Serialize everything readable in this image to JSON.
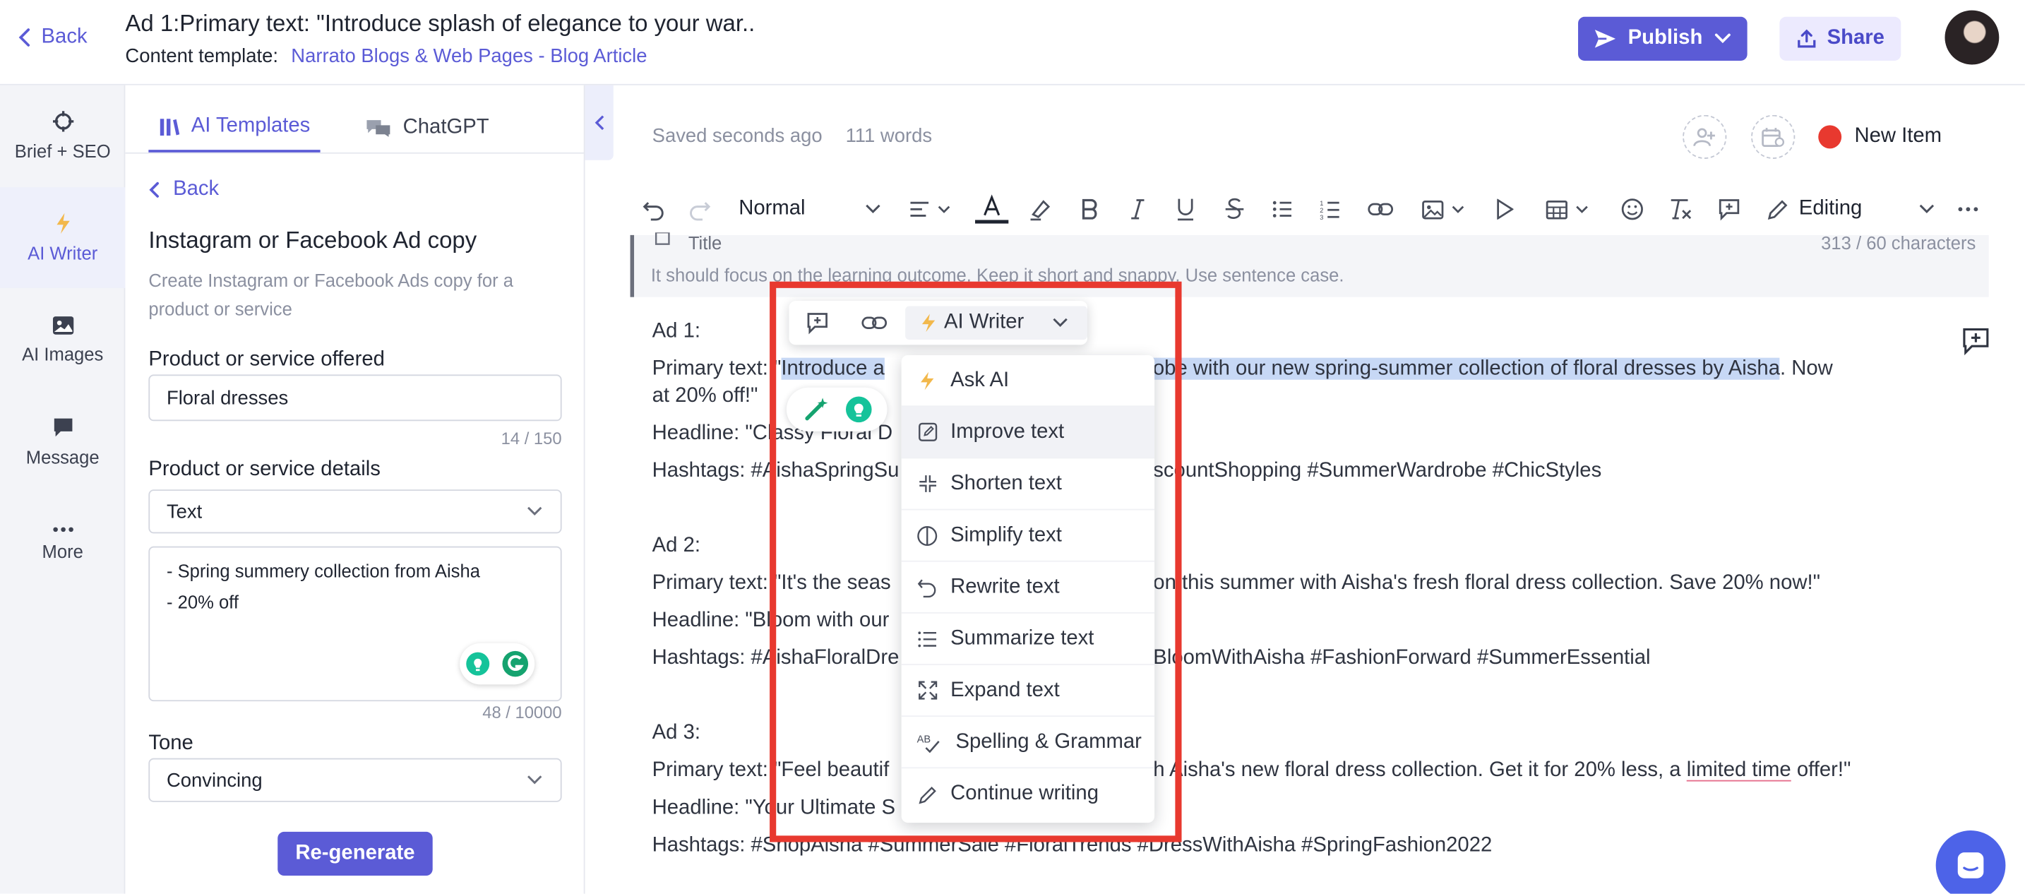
{
  "header": {
    "back_label": "Back",
    "title": "Ad 1:Primary text: \"Introduce splash of elegance to your war..",
    "template_label": "Content template:",
    "template_link": "Narrato Blogs & Web Pages - Blog Article",
    "publish_label": "Publish",
    "share_label": "Share"
  },
  "rail": {
    "items": [
      {
        "label": "Brief + SEO",
        "icon": "crosshair-icon"
      },
      {
        "label": "AI Writer",
        "icon": "lightning-icon"
      },
      {
        "label": "AI Images",
        "icon": "image-icon"
      },
      {
        "label": "Message",
        "icon": "message-icon"
      },
      {
        "label": "More",
        "icon": "more-dots-icon"
      }
    ]
  },
  "panel": {
    "tabs": [
      {
        "label": "AI Templates",
        "icon": "library-icon"
      },
      {
        "label": "ChatGPT",
        "icon": "chat-bubbles-icon"
      }
    ],
    "back_label": "Back",
    "title": "Instagram or Facebook Ad copy",
    "description": "Create Instagram or Facebook Ads copy for a product or service",
    "product_label": "Product or service offered",
    "product_value": "Floral dresses",
    "product_counter": "14 / 150",
    "details_label": "Product or service details",
    "details_type": "Text",
    "details_lines": [
      "- Spring summery collection from Aisha",
      "- 20% off"
    ],
    "details_counter": "48 / 10000",
    "tone_label": "Tone",
    "tone_value": "Convincing",
    "regenerate_label": "Re-generate"
  },
  "editor": {
    "saved_status": "Saved seconds ago",
    "word_count": "111 words",
    "new_item_label": "New Item",
    "status_color": "#e8392f",
    "toolbar": {
      "format_value": "Normal",
      "mode_label": "Editing"
    },
    "title_field": {
      "label": "Title",
      "counter": "313 / 60 characters",
      "hint": "It should focus on the learning outcome. Keep it short and snappy. Use sentence case."
    },
    "ads": [
      {
        "heading": "Ad 1:",
        "primary_prefix": "Primary text: \"",
        "primary_selected_left": "Introduce a",
        "primary_selected_right": "r wardrobe with our new spring-summer collection of floral dresses by Aisha",
        "primary_rest": ". Now",
        "primary_wrap": "at 20% off!\"",
        "headline_left": "Headline: \"Classy Floral D",
        "hashtags_left": "Hashtags: #AishaSpringSu",
        "hashtags_right": "scountShopping #SummerWardrobe #ChicStyles"
      },
      {
        "heading": "Ad 2:",
        "primary_left": "Primary text: \"It's the seas",
        "primary_right": "on this summer with Aisha's fresh floral dress collection. Save 20% now!\"",
        "headline_left": "Headline: \"Bloom with our",
        "hashtags_left": "Hashtags: #AishaFloralDre",
        "hashtags_right": "BloomWithAisha #FashionForward #SummerEssential"
      },
      {
        "heading": "Ad 3:",
        "primary_left": "Primary text: \"Feel beautif",
        "primary_right_a": "h Aisha's new floral dress collection. Get it for 20% less, a ",
        "primary_right_u": "limited time",
        "primary_right_b": " offer!\"",
        "headline_left": "Headline: \"Your Ultimate S",
        "hashtags_left": "Hashtags: #ShopAisha #SummerSale #FloralTrends #DressWithAisha #SpringFashion2022"
      }
    ]
  },
  "floating_toolbar": {
    "ai_writer_label": "AI Writer"
  },
  "ai_menu": {
    "items": [
      {
        "label": "Ask AI",
        "icon": "lightning-icon"
      },
      {
        "label": "Improve text",
        "icon": "edit-square-icon"
      },
      {
        "label": "Shorten text",
        "icon": "shrink-icon"
      },
      {
        "label": "Simplify text",
        "icon": "half-circle-icon"
      },
      {
        "label": "Rewrite text",
        "icon": "undo-arrow-icon"
      },
      {
        "label": "Summarize text",
        "icon": "list-icon"
      },
      {
        "label": "Expand text",
        "icon": "expand-icon"
      },
      {
        "label": "Spelling & Grammar",
        "icon": "spellcheck-icon"
      },
      {
        "label": "Continue writing",
        "icon": "pencil-icon"
      }
    ]
  },
  "colors": {
    "accent": "#5b5bd6",
    "highlight_box": "#e8392f",
    "selection": "#c7d8f5"
  }
}
